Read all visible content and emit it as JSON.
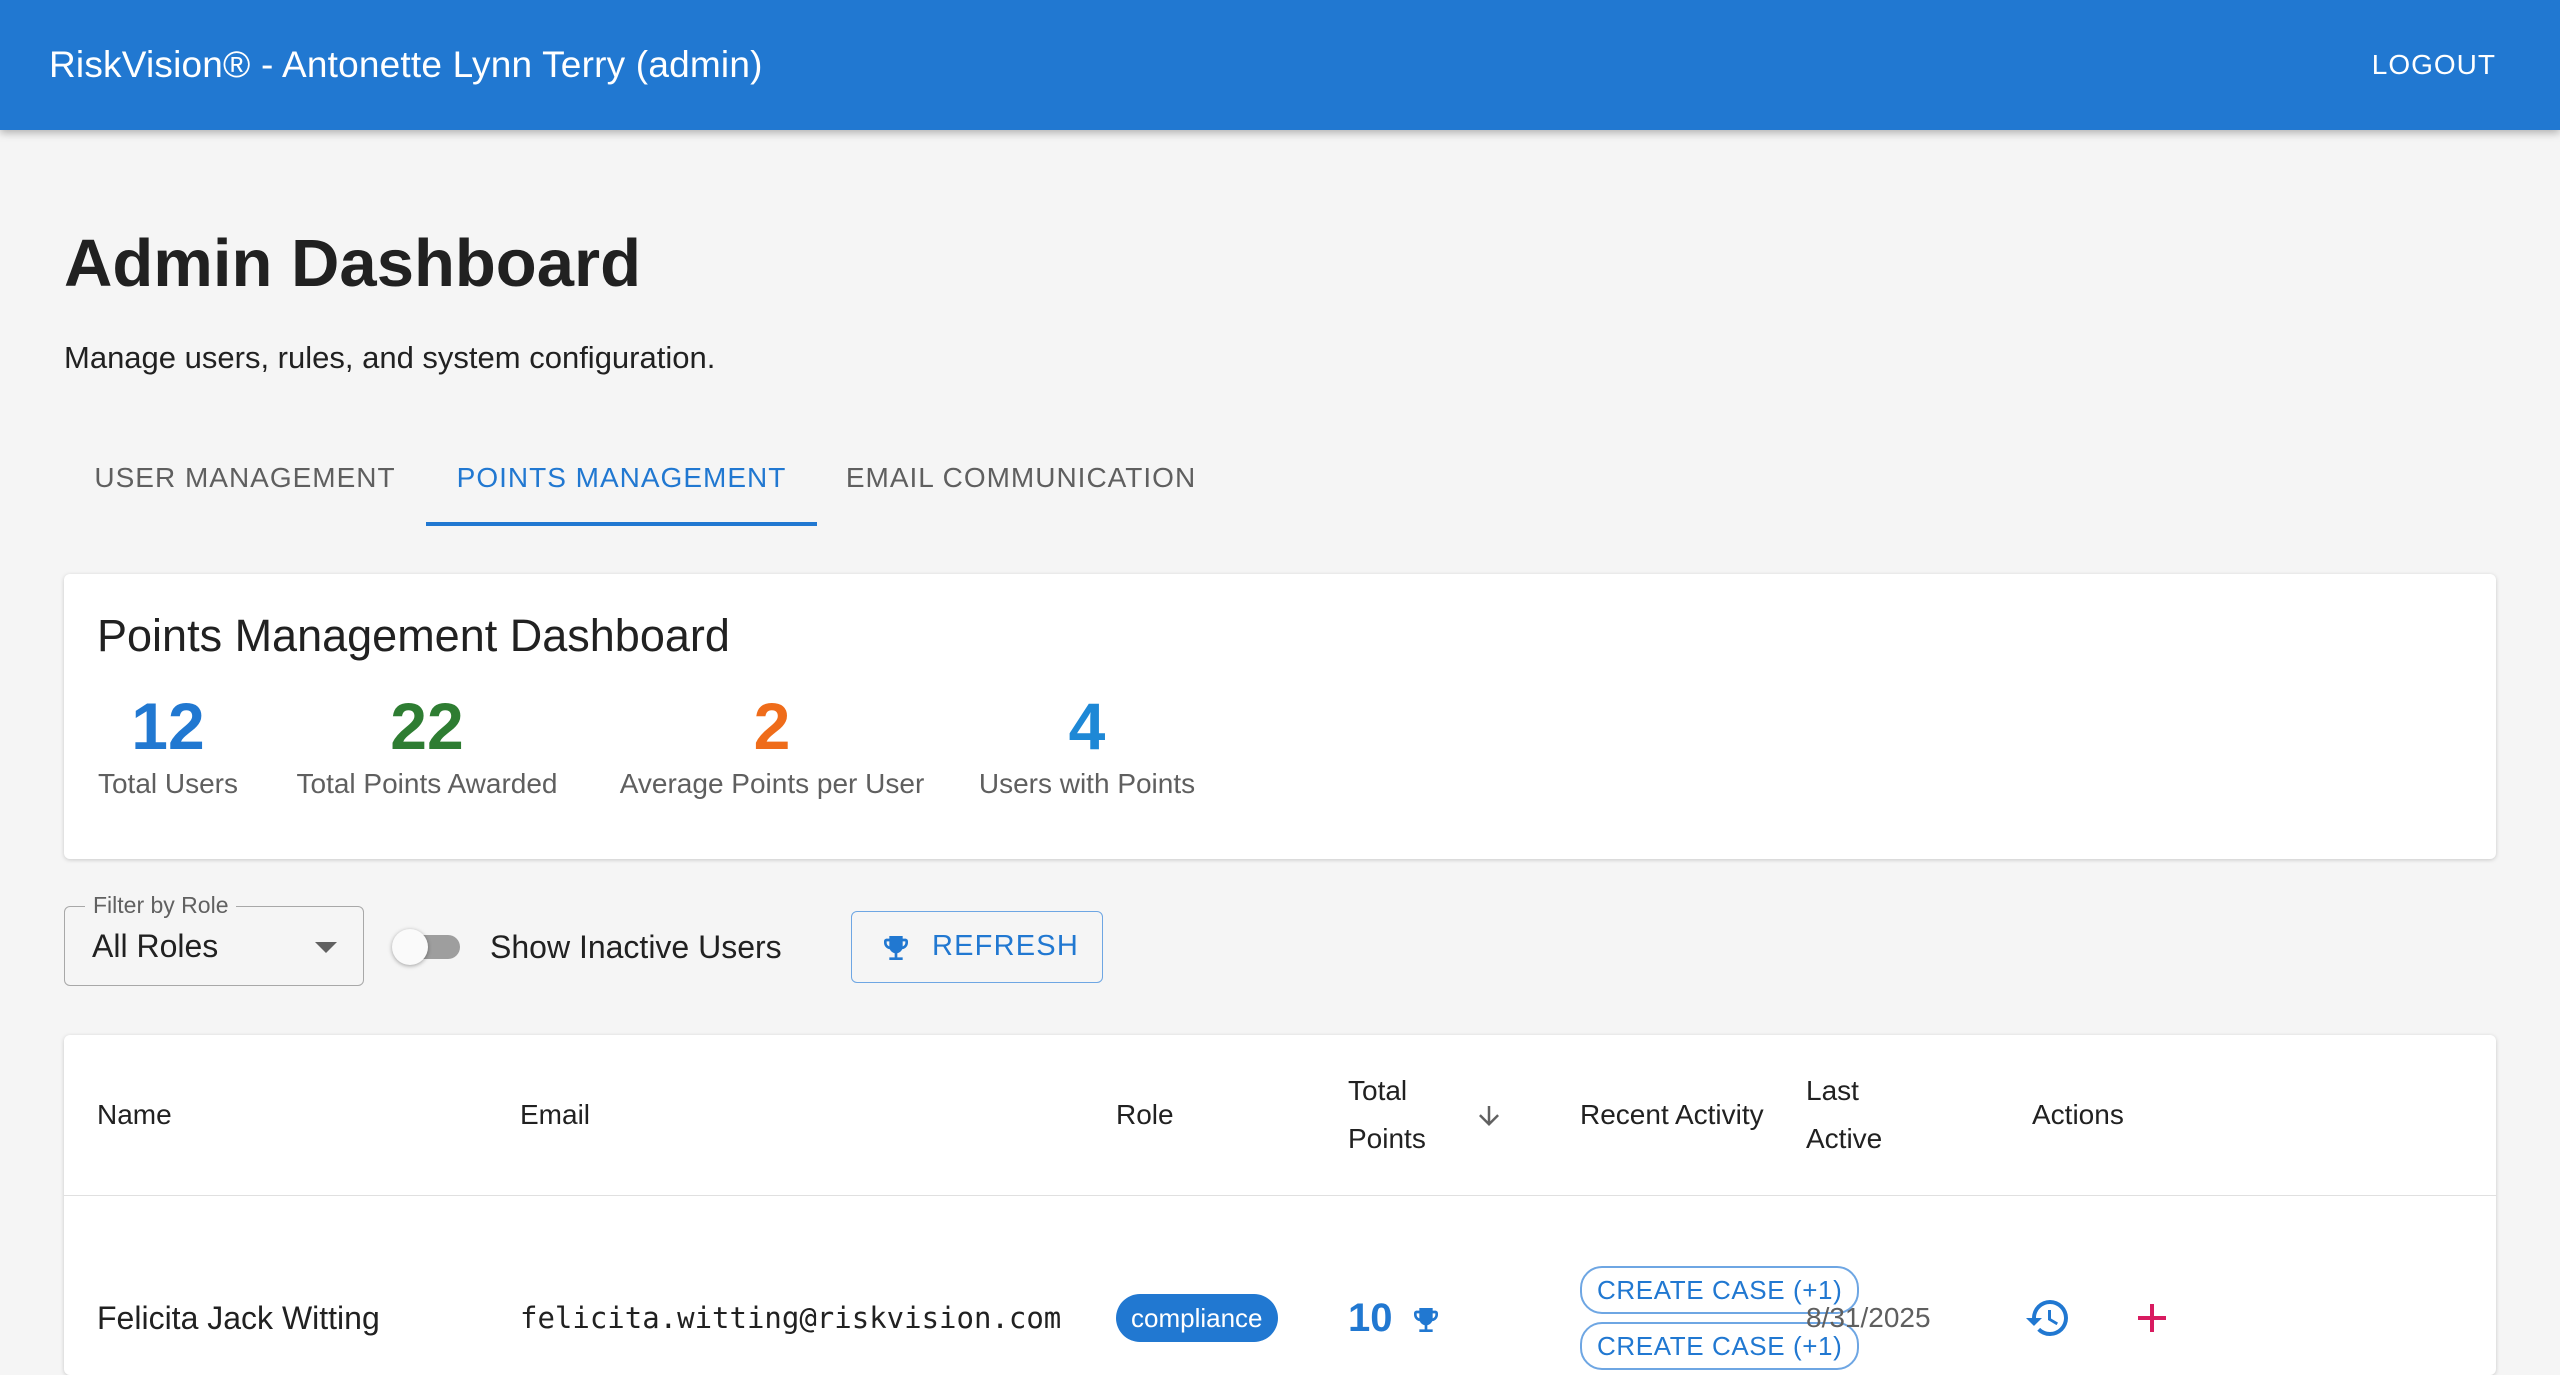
{
  "appbar": {
    "title": "RiskVision® - Antonette Lynn Terry (admin)",
    "logout_label": "LOGOUT"
  },
  "page": {
    "title": "Admin Dashboard",
    "subtitle": "Manage users, rules, and system configuration."
  },
  "tabs": [
    {
      "label": "USER MANAGEMENT",
      "active": false
    },
    {
      "label": "POINTS MANAGEMENT",
      "active": true
    },
    {
      "label": "EMAIL COMMUNICATION",
      "active": false
    }
  ],
  "stats": {
    "title": "Points Management Dashboard",
    "items": [
      {
        "value": "12",
        "label": "Total Users",
        "color": "#2178d1"
      },
      {
        "value": "22",
        "label": "Total Points Awarded",
        "color": "#2e7d32"
      },
      {
        "value": "2",
        "label": "Average Points per User",
        "color": "#ef6c1a"
      },
      {
        "value": "4",
        "label": "Users with Points",
        "color": "#1e88d6"
      }
    ]
  },
  "filters": {
    "role_label": "Filter by Role",
    "role_value": "All Roles",
    "show_inactive_label": "Show Inactive Users",
    "show_inactive_on": false,
    "refresh_label": "REFRESH",
    "refresh_icon": "trophy-icon"
  },
  "table": {
    "columns": {
      "name": "Name",
      "email": "Email",
      "role": "Role",
      "total_points_line1": "Total",
      "total_points_line2": "Points",
      "recent_activity": "Recent Activity",
      "last_active_line1": "Last",
      "last_active_line2": "Active",
      "actions": "Actions"
    },
    "sort": {
      "column": "Total Points",
      "direction": "descending",
      "icon": "arrow-down-icon"
    },
    "rows": [
      {
        "name": "Felicita Jack Witting",
        "email": "felicita.witting@riskvision.com",
        "role": "compliance",
        "points": "10",
        "recent_activity": [
          "CREATE CASE (+1)",
          "CREATE CASE (+1)"
        ],
        "last_active": "8/31/2025",
        "actions": [
          "history-icon",
          "plus-icon"
        ]
      }
    ]
  },
  "colors": {
    "primary": "#2178d1",
    "danger": "#d81b60",
    "background": "#f5f5f5"
  }
}
